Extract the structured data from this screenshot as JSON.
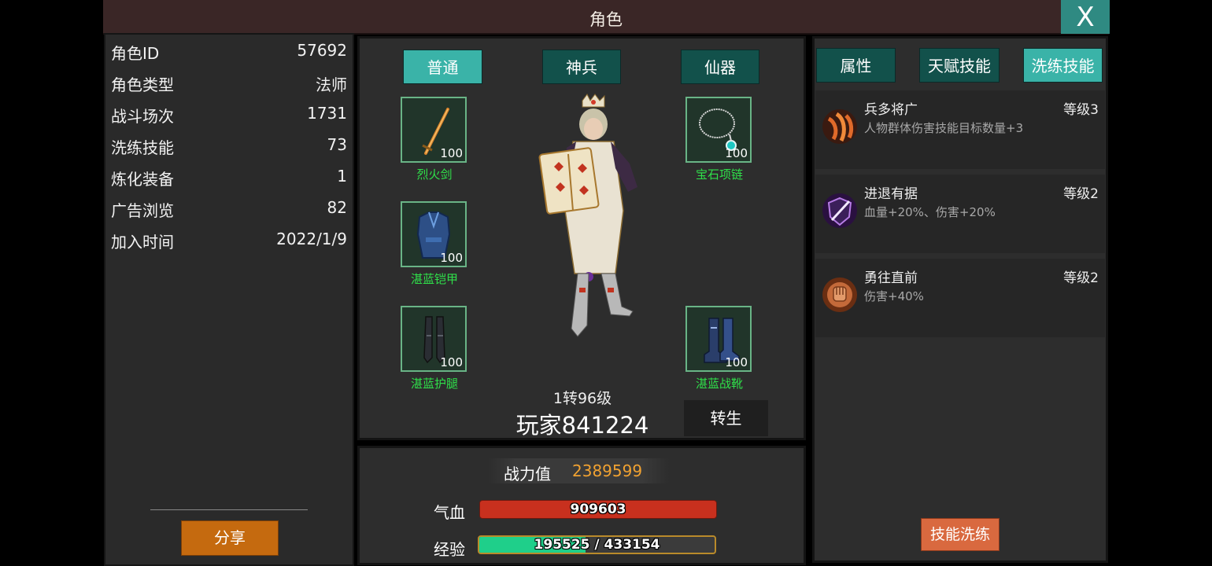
{
  "window": {
    "title": "角色",
    "close_label": "X"
  },
  "stats": [
    {
      "label": "角色ID",
      "value": "57692"
    },
    {
      "label": "角色类型",
      "value": "法师"
    },
    {
      "label": "战斗场次",
      "value": "1731"
    },
    {
      "label": "洗练技能",
      "value": "73"
    },
    {
      "label": "炼化装备",
      "value": "1"
    },
    {
      "label": "广告浏览",
      "value": "82"
    },
    {
      "label": "加入时间",
      "value": "2022/1/9"
    }
  ],
  "share_label": "分享",
  "equip_tabs": [
    {
      "label": "普通",
      "active": true
    },
    {
      "label": "神兵",
      "active": false
    },
    {
      "label": "仙器",
      "active": false
    }
  ],
  "equipment": {
    "weapon": {
      "name": "烈火剑",
      "level": "100",
      "icon": "sword-icon"
    },
    "armor": {
      "name": "湛蓝铠甲",
      "level": "100",
      "icon": "armor-icon"
    },
    "legs": {
      "name": "湛蓝护腿",
      "level": "100",
      "icon": "leggings-icon"
    },
    "necklace": {
      "name": "宝石项链",
      "level": "100",
      "icon": "necklace-icon"
    },
    "boots": {
      "name": "湛蓝战靴",
      "level": "100",
      "icon": "boots-icon"
    }
  },
  "character": {
    "rank": "1转96级",
    "name": "玩家841224",
    "rebirth_label": "转生"
  },
  "power": {
    "label": "战力值",
    "value": "2389599"
  },
  "hp": {
    "label": "气血",
    "value": "909603"
  },
  "exp": {
    "label": "经验",
    "current": "195525",
    "separator": "/",
    "max": "433154",
    "fraction": 0.4514
  },
  "skill_tabs": [
    {
      "label": "属性",
      "active": false
    },
    {
      "label": "天赋技能",
      "active": false
    },
    {
      "label": "洗练技能",
      "active": true
    }
  ],
  "skills": [
    {
      "name": "兵多将广",
      "desc": "人物群体伤害技能目标数量+3",
      "level": "等级3",
      "icon": "fire-claw-icon"
    },
    {
      "name": "进退有据",
      "desc": "血量+20%、伤害+20%",
      "level": "等级2",
      "icon": "shield-slash-icon"
    },
    {
      "name": "勇往直前",
      "desc": "伤害+40%",
      "level": "等级2",
      "icon": "fist-icon"
    }
  ],
  "reset_label": "技能洗练",
  "colors": {
    "accent": "#3ab3a8",
    "tab_idle": "#12514b",
    "equip_name": "#2fe04a",
    "power_value": "#f1a231",
    "hp_bar": "#c8301e",
    "exp_bar": "#1fcf8a",
    "share_button": "#c56a0f",
    "reset_button": "#d9693f"
  }
}
